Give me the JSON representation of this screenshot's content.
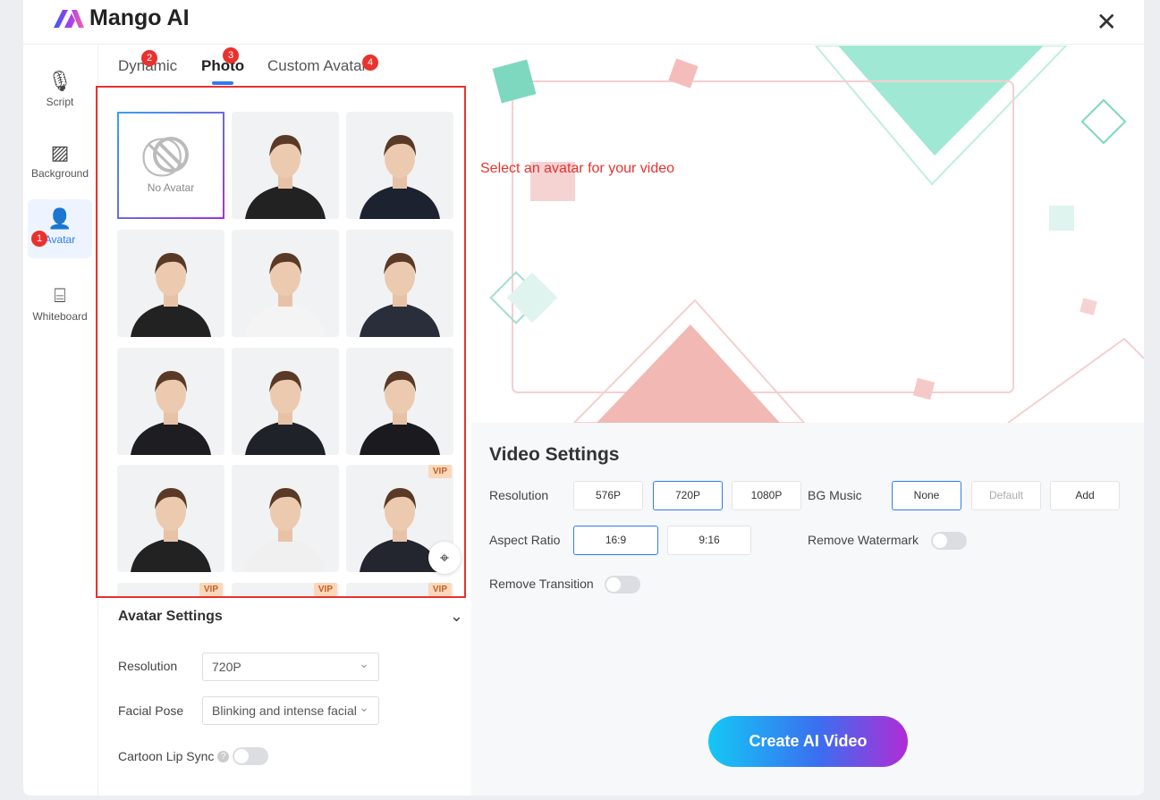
{
  "app": {
    "title": "Mango AI",
    "close_icon": "close-icon"
  },
  "nav": [
    {
      "label": "Script",
      "icon": "microphone-script-icon"
    },
    {
      "label": "Background",
      "icon": "background-icon"
    },
    {
      "label": "Avatar",
      "icon": "avatar-icon",
      "active": true
    },
    {
      "label": "Whiteboard",
      "icon": "whiteboard-icon"
    }
  ],
  "badges": [
    "1",
    "2",
    "3",
    "4"
  ],
  "tabs": [
    {
      "label": "Dynamic"
    },
    {
      "label": "Photo",
      "active": true
    },
    {
      "label": "Custom Avatar"
    }
  ],
  "grid": {
    "no_avatar_label": "No Avatar",
    "vip_label": "VIP"
  },
  "avatar_settings": {
    "title": "Avatar Settings",
    "resolution_label": "Resolution",
    "resolution_value": "720P",
    "facial_pose_label": "Facial Pose",
    "facial_pose_value": "Blinking and intense facial",
    "cartoon_lip_sync_label": "Cartoon Lip Sync",
    "cartoon_lip_sync_on": false
  },
  "preview": {
    "hint": "Select an avatar for your video"
  },
  "video_settings": {
    "title": "Video Settings",
    "resolution_label": "Resolution",
    "resolutions": [
      "576P",
      "720P",
      "1080P"
    ],
    "resolution_selected": "720P",
    "bg_music_label": "BG Music",
    "bg_music_options": [
      "None",
      "Default",
      "Add"
    ],
    "bg_music_selected": "None",
    "aspect_ratio_label": "Aspect Ratio",
    "aspect_ratios": [
      "16:9",
      "9:16"
    ],
    "aspect_selected": "16:9",
    "remove_watermark_label": "Remove Watermark",
    "remove_watermark_on": false,
    "remove_transition_label": "Remove Transition",
    "remove_transition_on": false,
    "create_label": "Create AI Video"
  },
  "colors": {
    "accent": "#2f7bf0",
    "badge": "#e8322e",
    "highlight_box": "#e8322e"
  }
}
